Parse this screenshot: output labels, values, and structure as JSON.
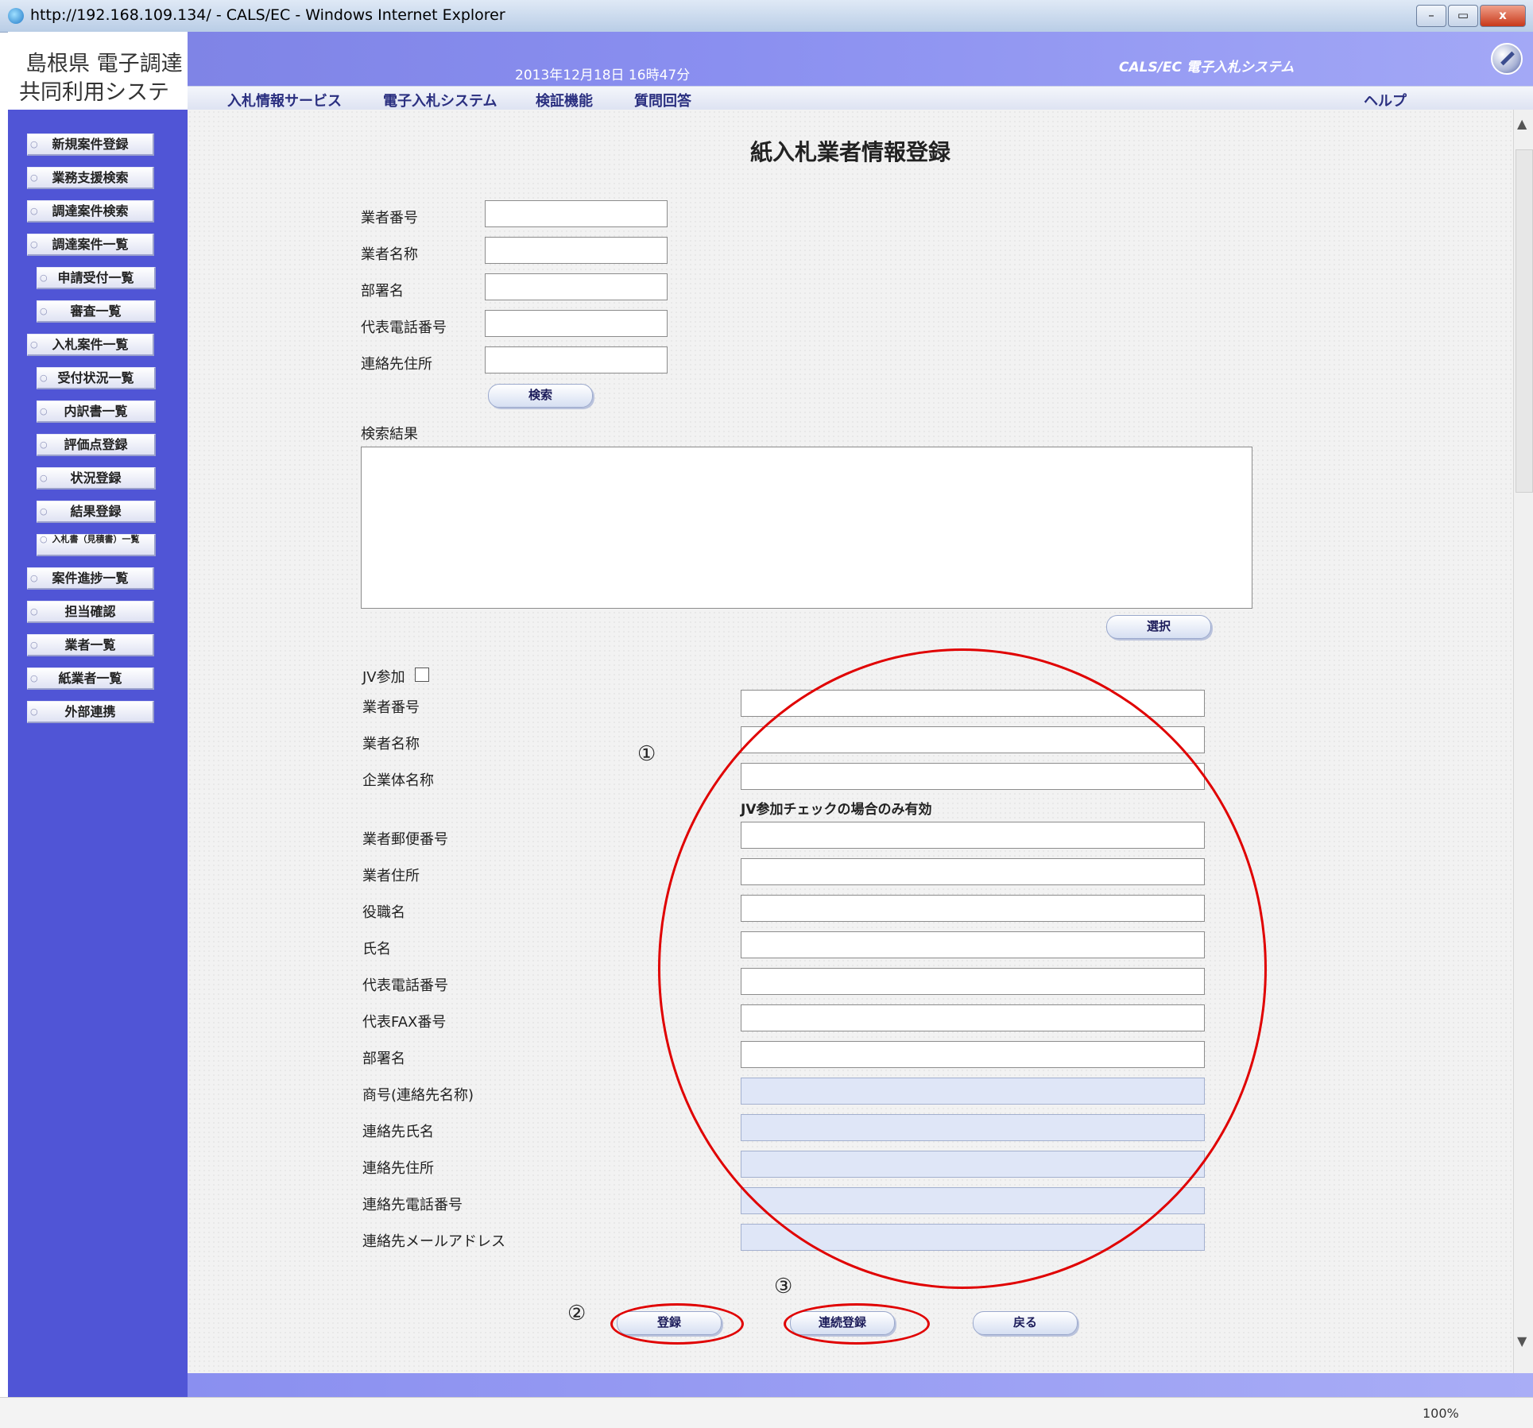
{
  "window": {
    "title": "http://192.168.109.134/ - CALS/EC - Windows Internet Explorer",
    "controls": [
      "–",
      "▭",
      "x"
    ]
  },
  "header": {
    "logo_line1": "島根県 電子調達",
    "logo_line2": "共同利用システム",
    "datetime": "2013年12月18日 16時47分",
    "system_name": "CALS/EC 電子入札システム",
    "tabs": [
      "入札情報サービス",
      "電子入札システム",
      "検証機能",
      "質問回答"
    ],
    "help": "ヘルプ"
  },
  "sidebar": {
    "items": [
      {
        "label": "新規案件登録"
      },
      {
        "label": "業務支援検索"
      },
      {
        "label": "調達案件検索"
      },
      {
        "label": "調達案件一覧"
      },
      {
        "label": "申請受付一覧"
      },
      {
        "label": "審査一覧"
      },
      {
        "label": "入札案件一覧"
      },
      {
        "label": "受付状況一覧"
      },
      {
        "label": "内訳書一覧"
      },
      {
        "label": "評価点登録"
      },
      {
        "label": "状況登録"
      },
      {
        "label": "結果登録"
      },
      {
        "label": "入札書（見積書）一覧"
      },
      {
        "label": "案件進捗一覧"
      },
      {
        "label": "担当確認"
      },
      {
        "label": "業者一覧"
      },
      {
        "label": "紙業者一覧"
      },
      {
        "label": "外部連携"
      }
    ]
  },
  "main": {
    "title": "紙入札業者情報登録",
    "search_fields": [
      {
        "label": "業者番号",
        "value": ""
      },
      {
        "label": "業者名称",
        "value": ""
      },
      {
        "label": "部署名",
        "value": ""
      },
      {
        "label": "代表電話番号",
        "value": ""
      },
      {
        "label": "連絡先住所",
        "value": ""
      }
    ],
    "search_button": "検索",
    "results_label": "検索結果",
    "select_button": "選択",
    "jv_label": "JV参加",
    "jv_note": "JV参加チェックの場合のみ有効",
    "form_fields": [
      {
        "label": "業者番号",
        "value": ""
      },
      {
        "label": "業者名称",
        "value": ""
      },
      {
        "label": "企業体名称",
        "value": ""
      },
      {
        "label": "業者郵便番号",
        "value": ""
      },
      {
        "label": "業者住所",
        "value": ""
      },
      {
        "label": "役職名",
        "value": ""
      },
      {
        "label": "氏名",
        "value": ""
      },
      {
        "label": "代表電話番号",
        "value": ""
      },
      {
        "label": "代表FAX番号",
        "value": ""
      },
      {
        "label": "部署名",
        "value": ""
      },
      {
        "label": "商号(連絡先名称)",
        "value": ""
      },
      {
        "label": "連絡先氏名",
        "value": ""
      },
      {
        "label": "連絡先住所",
        "value": ""
      },
      {
        "label": "連絡先電話番号",
        "value": ""
      },
      {
        "label": "連絡先メールアドレス",
        "value": ""
      }
    ],
    "register_button": "登録",
    "continuous_register_button": "連続登録",
    "back_button": "戻る"
  },
  "annotations": {
    "one": "①",
    "two": "②",
    "three": "③"
  },
  "status": {
    "zoom": "100%"
  },
  "colors": {
    "sidebar": "#5055d6",
    "banner": "#8a8ff0",
    "annotation": "#e00000"
  }
}
